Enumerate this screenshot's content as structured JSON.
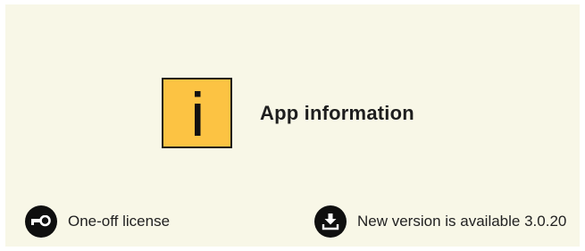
{
  "header": {
    "title": "App information",
    "icon": "info-icon",
    "badge_color": "#fcc343"
  },
  "license": {
    "icon": "key-icon",
    "label": "One-off license"
  },
  "update": {
    "icon": "download-icon",
    "label": "New version is available 3.0.20"
  }
}
